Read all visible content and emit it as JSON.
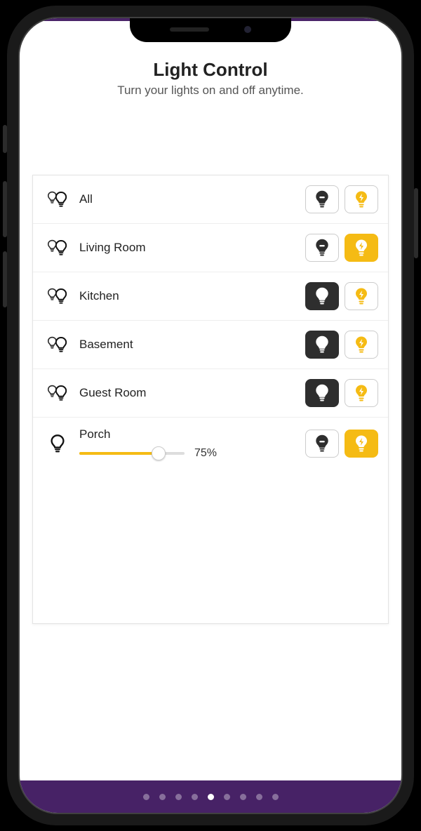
{
  "header": {
    "title": "Light Control",
    "subtitle": "Turn your lights on and off anytime."
  },
  "rows": [
    {
      "icon": "double",
      "label": "All",
      "off_state": "outline",
      "on_state": "outline",
      "has_slider": false
    },
    {
      "icon": "double",
      "label": "Living Room",
      "off_state": "outline",
      "on_state": "active",
      "has_slider": false
    },
    {
      "icon": "double",
      "label": "Kitchen",
      "off_state": "active",
      "on_state": "outline",
      "has_slider": false
    },
    {
      "icon": "double",
      "label": "Basement",
      "off_state": "active",
      "on_state": "outline",
      "has_slider": false
    },
    {
      "icon": "double",
      "label": "Guest Room",
      "off_state": "active",
      "on_state": "outline",
      "has_slider": false
    },
    {
      "icon": "single",
      "label": "Porch",
      "off_state": "outline",
      "on_state": "active",
      "has_slider": true,
      "slider_pct": 75,
      "slider_text": "75%"
    }
  ],
  "pager": {
    "count": 9,
    "active_index": 4
  }
}
